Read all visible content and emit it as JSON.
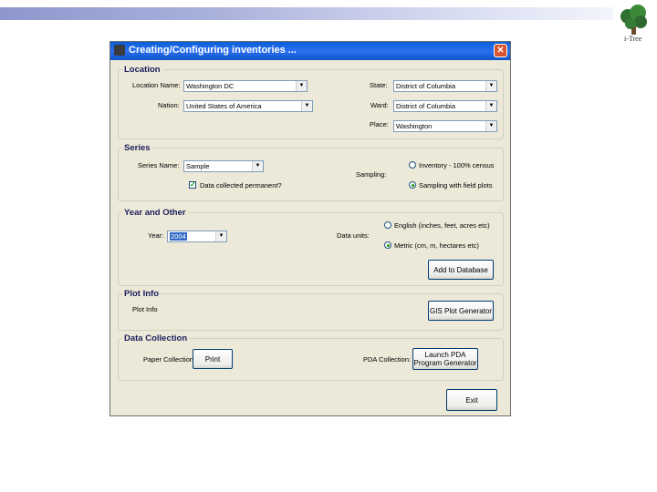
{
  "window": {
    "title": "Creating/Configuring inventories ...",
    "close_label": "✕"
  },
  "logo": {
    "text": "i-Tree"
  },
  "location": {
    "legend": "Location",
    "location_name_label": "Location Name:",
    "location_name_value": "Washington DC",
    "nation_label": "Nation:",
    "nation_value": "United States of America",
    "state_label": "State:",
    "state_value": "District of Columbia",
    "ward_label": "Ward:",
    "ward_value": "District of Columbia",
    "place_label": "Place:",
    "place_value": "Washington"
  },
  "series": {
    "legend": "Series",
    "series_name_label": "Series Name:",
    "series_name_value": "Sample",
    "data_permanent_label": "Data collected permanent?",
    "data_permanent_checked": true,
    "sampling_label": "Sampling:",
    "options": [
      "Inventory - 100% census",
      "Sampling with field plots"
    ],
    "selected": "Sampling with field plots"
  },
  "year_other": {
    "legend": "Year and Other",
    "year_label": "Year:",
    "year_value": "2004",
    "data_units_label": "Data units:",
    "options": [
      "English (inches, feet, acres etc)",
      "Metric (cm, m, hectares etc)"
    ],
    "selected": "Metric (cm, m, hectares etc)",
    "add_button": "Add to Database"
  },
  "plot_info": {
    "legend": "Plot Info",
    "text": "Plot Info",
    "gis_button": "GIS Plot Generator"
  },
  "data_collection": {
    "legend": "Data Collection",
    "paper_label": "Paper Collection:",
    "print_button": "Print",
    "pda_label": "PDA Collection:",
    "pda_button": "Launch PDA\nProgram Generator"
  },
  "exit_button": "Exit"
}
